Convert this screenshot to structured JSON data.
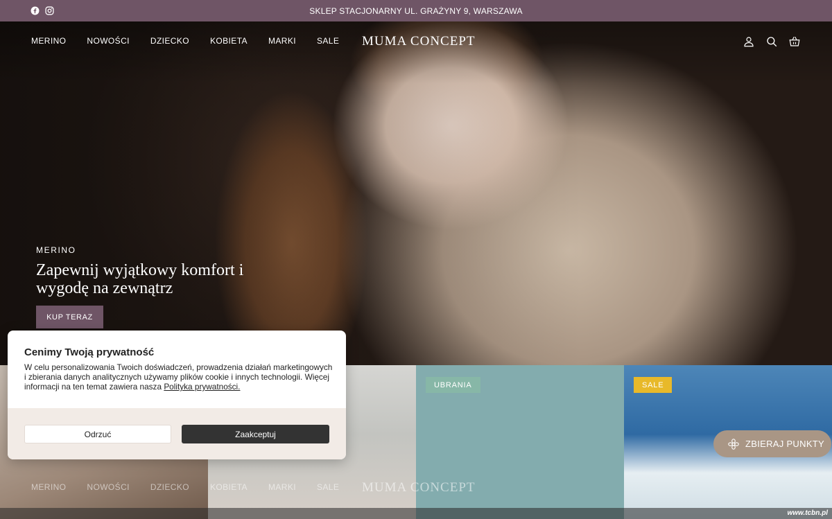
{
  "announcement": {
    "text": "SKLEP STACJONARNY UL. GRAŻYNY 9, WARSZAWA",
    "social_icons": [
      "facebook-icon",
      "instagram-icon"
    ]
  },
  "header": {
    "logo": "MUMA CONCEPT",
    "nav": [
      "MERINO",
      "NOWOŚCI",
      "DZIECKO",
      "KOBIETA",
      "MARKI",
      "SALE"
    ],
    "icons": [
      "account-icon",
      "search-icon",
      "cart-icon"
    ]
  },
  "hero": {
    "kicker": "MERINO",
    "title": "Zapewnij wyjątkowy komfort i wygodę na zewnątrz",
    "button": "KUP TERAZ"
  },
  "tiles": [
    {
      "badge": ""
    },
    {
      "badge": ""
    },
    {
      "badge": "UBRANIA"
    },
    {
      "badge": "SALE"
    }
  ],
  "cookie": {
    "title": "Cenimy Twoją prywatność",
    "body": "W celu personalizowania Twoich doświadczeń, prowadzenia działań marketingowych i zbierania danych analitycznych używamy plików cookie i innych technologii. Więcej informacji na ten temat zawiera nasza",
    "link": "Polityka prywatności.",
    "reject": "Odrzuć",
    "accept": "Zaakceptuj"
  },
  "rewards": {
    "label": "ZBIERAJ PUNKTY"
  },
  "watermark": "www.tcbn.pl",
  "colors": {
    "brand": "#6f5566",
    "rewards": "#a99685",
    "badge_ubrania": "#87b7a7",
    "badge_sale": "#e8b92a"
  }
}
